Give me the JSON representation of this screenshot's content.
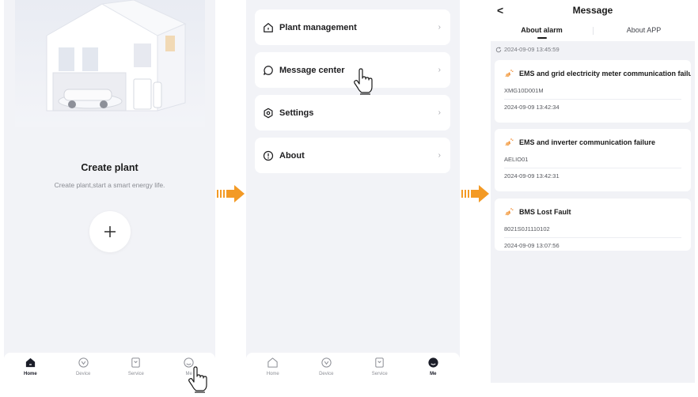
{
  "screen1": {
    "title": "Create plant",
    "subtitle": "Create plant,start a smart energy life.",
    "add_button_glyph": "+",
    "tabs": [
      {
        "label": "Home",
        "icon": "home-icon",
        "active": true
      },
      {
        "label": "Device",
        "icon": "device-icon",
        "active": false
      },
      {
        "label": "Service",
        "icon": "service-icon",
        "active": false
      },
      {
        "label": "Me",
        "icon": "me-icon",
        "active": false
      }
    ]
  },
  "screen2": {
    "menu": [
      {
        "label": "Plant management",
        "icon": "home-icon"
      },
      {
        "label": "Message center",
        "icon": "message-icon"
      },
      {
        "label": "Settings",
        "icon": "settings-icon"
      },
      {
        "label": "About",
        "icon": "info-icon"
      }
    ],
    "chevron": "›",
    "tabs": [
      {
        "label": "Home",
        "icon": "home-icon",
        "active": false
      },
      {
        "label": "Device",
        "icon": "device-icon",
        "active": false
      },
      {
        "label": "Service",
        "icon": "service-icon",
        "active": false
      },
      {
        "label": "Me",
        "icon": "me-icon",
        "active": true
      }
    ]
  },
  "screen3": {
    "back_glyph": "<",
    "title": "Message",
    "tabs": [
      {
        "label": "About alarm",
        "active": true
      },
      {
        "label": "About APP",
        "active": false
      }
    ],
    "refresh_time": "2024-09-09 13:45:59",
    "alarms": [
      {
        "title": "EMS and grid electricity meter communication failu",
        "id": "XMG10D001M",
        "time": "2024-09-09 13:42:34"
      },
      {
        "title": "EMS and inverter communication failure",
        "id": "AELIO01",
        "time": "2024-09-09 13:42:31"
      },
      {
        "title": "BMS Lost Fault",
        "id": "8021S0J1110102",
        "time": "2024-09-09 13:07:56"
      }
    ]
  },
  "colors": {
    "arrow": "#f39a25",
    "alarm_icon": "#f08a2c",
    "background": "#f2f3f7",
    "active_tab": "#1b1d28"
  }
}
